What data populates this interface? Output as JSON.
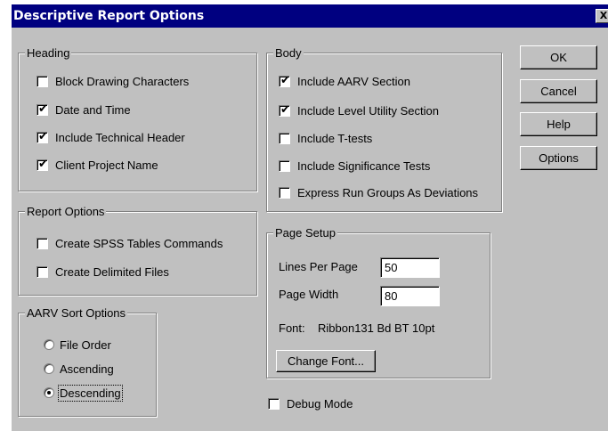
{
  "window": {
    "title": "Descriptive Report Options",
    "close": "X"
  },
  "heading": {
    "legend": "Heading",
    "items": [
      {
        "label": "Block Drawing Characters",
        "checked": false
      },
      {
        "label": "Date and Time",
        "checked": true
      },
      {
        "label": "Include Technical Header",
        "checked": true
      },
      {
        "label": "Client Project Name",
        "checked": true
      }
    ]
  },
  "report_options": {
    "legend": "Report Options",
    "items": [
      {
        "label": "Create SPSS Tables Commands",
        "checked": false
      },
      {
        "label": "Create Delimited Files",
        "checked": false
      }
    ]
  },
  "aarv_sort": {
    "legend": "AARV Sort Options",
    "items": [
      {
        "label": "File Order",
        "selected": false
      },
      {
        "label": "Ascending",
        "selected": false
      },
      {
        "label": "Descending",
        "selected": true
      }
    ]
  },
  "body": {
    "legend": "Body",
    "items": [
      {
        "label": "Include AARV Section",
        "checked": true
      },
      {
        "label": "Include Level Utility Section",
        "checked": true
      },
      {
        "label": "Include T-tests",
        "checked": false
      },
      {
        "label": "Include Significance Tests",
        "checked": false
      },
      {
        "label": "Express Run Groups As Deviations",
        "checked": false
      }
    ]
  },
  "page_setup": {
    "legend": "Page Setup",
    "lines_per_page_label": "Lines Per Page",
    "lines_per_page_value": "50",
    "page_width_label": "Page Width",
    "page_width_value": "80",
    "font_label": "Font:",
    "font_value": "Ribbon131 Bd BT 10pt",
    "change_font": "Change Font..."
  },
  "debug_mode": {
    "label": "Debug Mode",
    "checked": false
  },
  "buttons": {
    "ok": "OK",
    "cancel": "Cancel",
    "help": "Help",
    "options": "Options"
  },
  "check_glyph": "✔"
}
